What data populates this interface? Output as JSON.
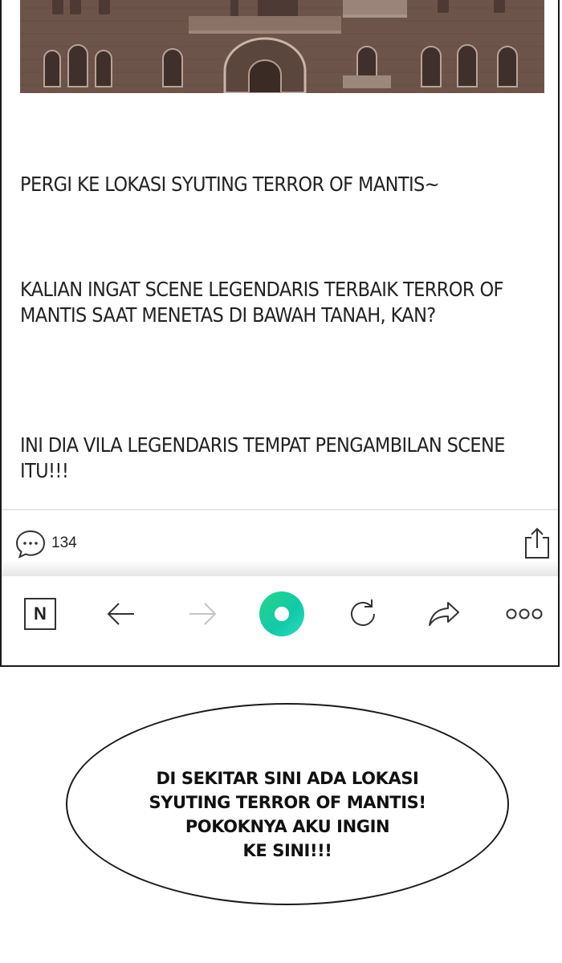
{
  "post": {
    "paragraphs": [
      "PERGI KE LOKASI SYUTING TERROR OF MANTIS~",
      "KALIAN INGAT SCENE LEGENDARIS TERBAIK TERROR OF MANTIS SAAT MENETAS DI BAWAH TANAH, KAN?",
      "INI DIA VILA LEGENDARIS TEMPAT PENGAMBILAN SCENE ITU!!!"
    ]
  },
  "actions": {
    "comment_count": "134",
    "comment_icon": "comment-bubble-icon",
    "share_icon": "share-icon"
  },
  "toolbar": {
    "items": [
      {
        "icon": "n-logo",
        "label": "N"
      },
      {
        "icon": "arrow-left-icon"
      },
      {
        "icon": "arrow-right-icon",
        "disabled": true
      },
      {
        "icon": "green-home-button"
      },
      {
        "icon": "refresh-icon"
      },
      {
        "icon": "forward-share-icon"
      },
      {
        "icon": "more-icon"
      }
    ],
    "accent": "#1fd09c"
  },
  "balloon": {
    "lines": [
      "DI SEKITAR SINI ADA LOKASI",
      "SYUTING TERROR OF MANTIS!",
      "POKOKNYA AKU INGIN",
      "KE SINI!!!"
    ]
  }
}
